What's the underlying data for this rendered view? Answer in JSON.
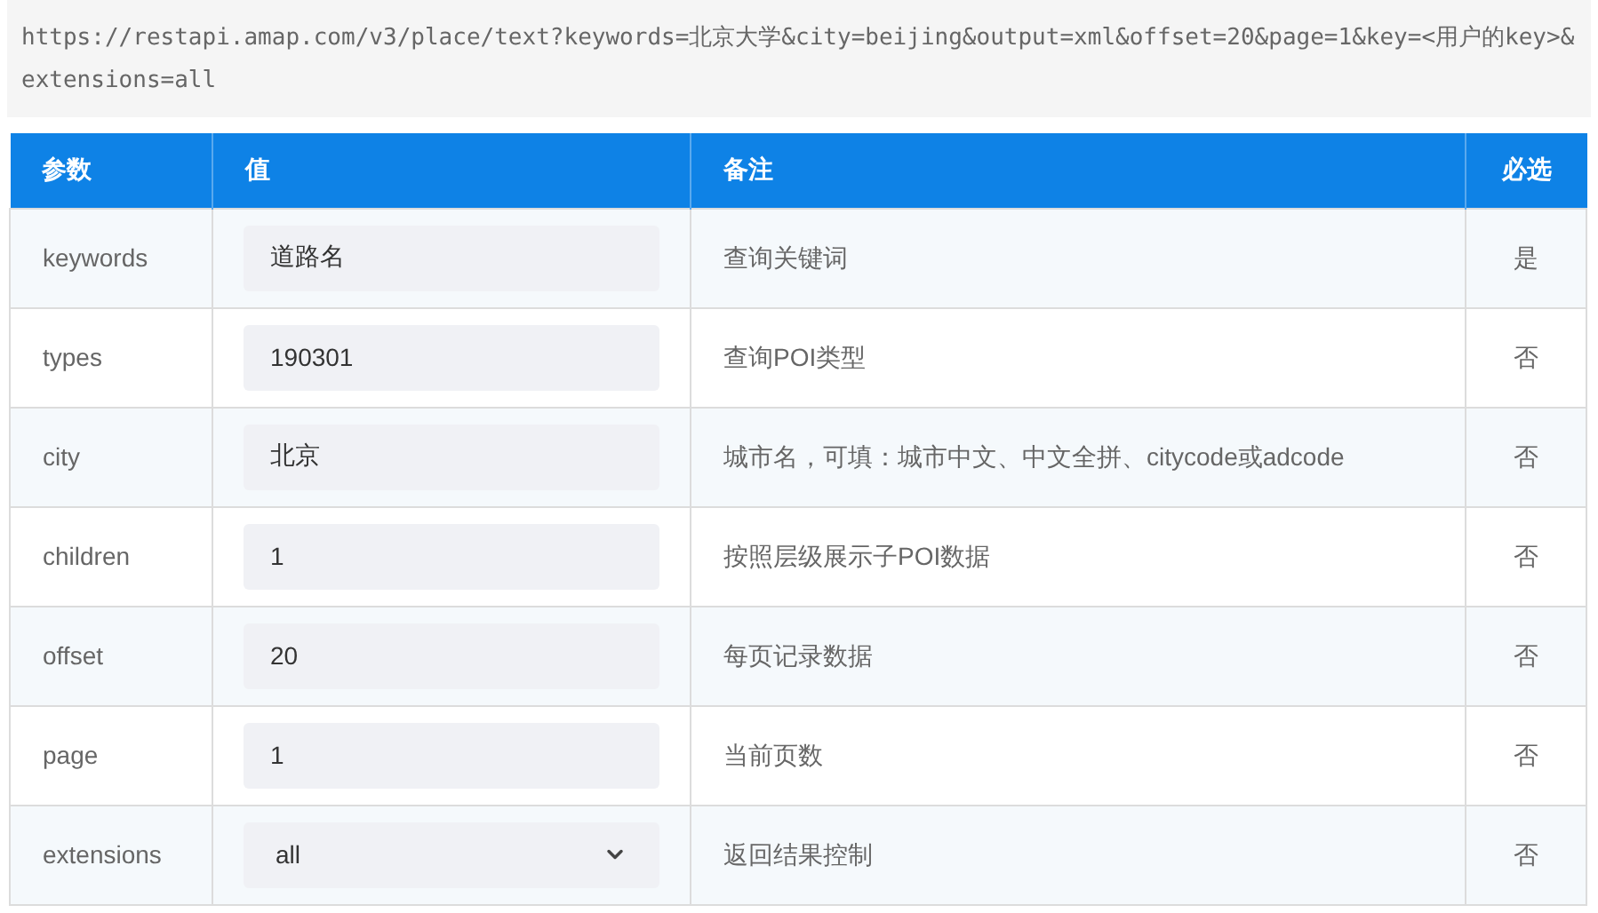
{
  "url": "https://restapi.amap.com/v3/place/text?keywords=北京大学&city=beijing&output=xml&offset=20&page=1&key=<用户的key>&extensions=all",
  "table": {
    "columns": [
      "参数",
      "值",
      "备注",
      "必选"
    ],
    "rows": [
      {
        "param": "keywords",
        "kind": "input",
        "value": "道路名",
        "note": "查询关键词",
        "required": "是"
      },
      {
        "param": "types",
        "kind": "input",
        "value": "190301",
        "note": "查询POI类型",
        "required": "否"
      },
      {
        "param": "city",
        "kind": "input",
        "value": "北京",
        "note": "城市名，可填：城市中文、中文全拼、citycode或adcode",
        "required": "否"
      },
      {
        "param": "children",
        "kind": "input",
        "value": "1",
        "note": "按照层级展示子POI数据",
        "required": "否"
      },
      {
        "param": "offset",
        "kind": "input",
        "value": "20",
        "note": "每页记录数据",
        "required": "否"
      },
      {
        "param": "page",
        "kind": "input",
        "value": "1",
        "note": "当前页数",
        "required": "否"
      },
      {
        "param": "extensions",
        "kind": "select",
        "value": "all",
        "note": "返回结果控制",
        "required": "否"
      }
    ]
  }
}
